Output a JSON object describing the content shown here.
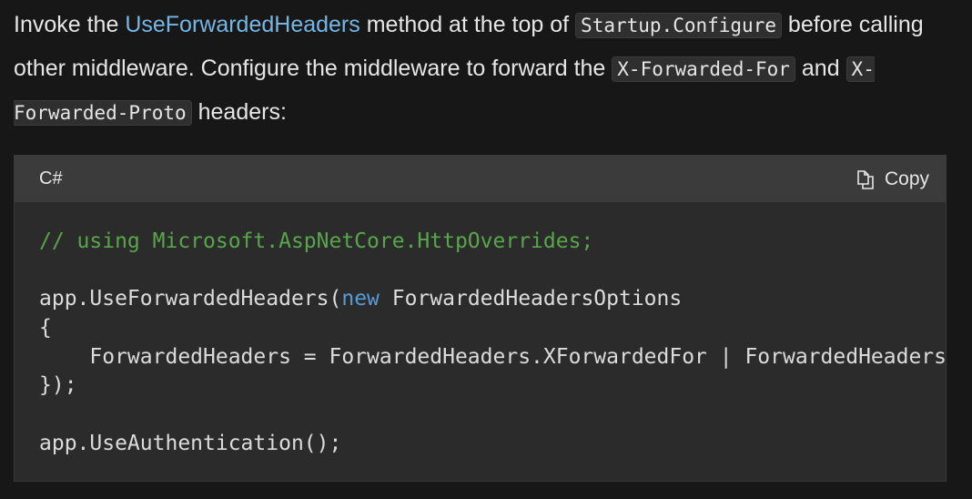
{
  "paragraph": {
    "t1": "Invoke the ",
    "link": "UseForwardedHeaders",
    "t2": " method at the top of ",
    "code1": "Startup.Configure",
    "t3": " before calling other middleware. Configure the middleware to forward the ",
    "code2": "X-Forwarded-For",
    "t4": " and ",
    "code3": "X-Forwarded-Proto",
    "t5": " headers:"
  },
  "code_block": {
    "language": "C#",
    "copy_label": "Copy",
    "copy_icon": "copy-icon",
    "lines": {
      "l1": "// using Microsoft.AspNetCore.HttpOverrides;",
      "l2": "",
      "l3a": "app.UseForwardedHeaders(",
      "l3kw": "new",
      "l3b": " ForwardedHeadersOptions",
      "l4": "{",
      "l5": "    ForwardedHeaders = ForwardedHeaders.XForwardedFor | ForwardedHeaders.XForwardedProto",
      "l6": "});",
      "l7": "",
      "l8": "app.UseAuthentication();"
    },
    "colors": {
      "comment": "#57a64a",
      "keyword": "#569cd6",
      "link": "#75b6e7"
    }
  }
}
